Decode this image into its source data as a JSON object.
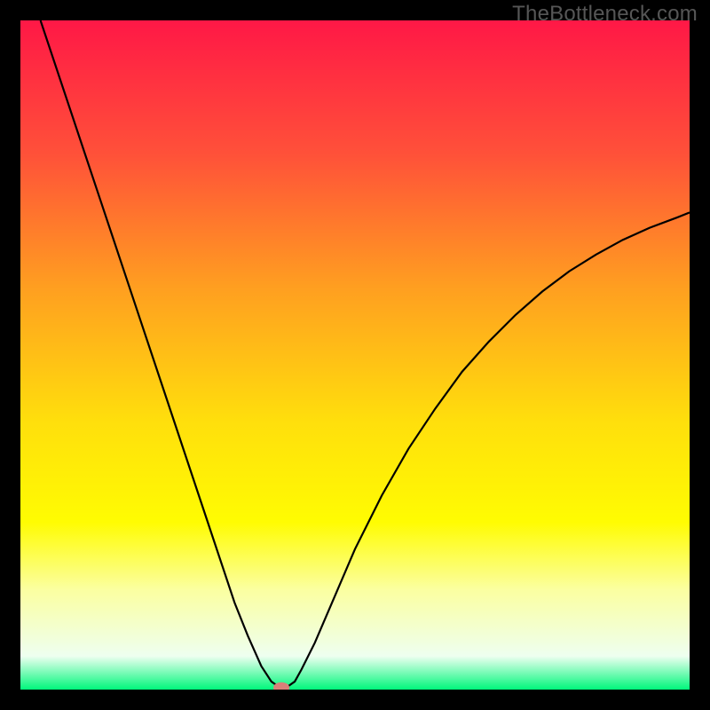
{
  "watermark": "TheBottleneck.com",
  "chart_data": {
    "type": "line",
    "title": "",
    "xlabel": "",
    "ylabel": "",
    "xlim": [
      0,
      100
    ],
    "ylim": [
      0,
      100
    ],
    "grid": false,
    "legend": false,
    "background_gradient": {
      "stops": [
        {
          "pct": 0,
          "color": "#ff1846"
        },
        {
          "pct": 20,
          "color": "#ff5139"
        },
        {
          "pct": 40,
          "color": "#ff9f20"
        },
        {
          "pct": 60,
          "color": "#ffdf0c"
        },
        {
          "pct": 75,
          "color": "#fffc02"
        },
        {
          "pct": 85,
          "color": "#fbffa0"
        },
        {
          "pct": 95,
          "color": "#eefff0"
        },
        {
          "pct": 100,
          "color": "#00f77b"
        }
      ]
    },
    "series": [
      {
        "name": "bottleneck-curve",
        "color": "#000000",
        "width": 2.2,
        "x": [
          3,
          6,
          9,
          12,
          15,
          18,
          21,
          24,
          27,
          30,
          32,
          34,
          36,
          37.5,
          38.5,
          39,
          40,
          41,
          42,
          44,
          47,
          50,
          54,
          58,
          62,
          66,
          70,
          74,
          78,
          82,
          86,
          90,
          94,
          98,
          100
        ],
        "y": [
          100,
          91,
          82,
          73,
          64,
          55,
          46,
          37,
          28,
          19,
          13,
          8,
          3.5,
          1.2,
          0.5,
          0.3,
          0.5,
          1.2,
          3,
          7,
          14,
          21,
          29,
          36,
          42,
          47.5,
          52,
          56,
          59.5,
          62.5,
          65,
          67.2,
          69,
          70.5,
          71.3
        ]
      }
    ],
    "marker": {
      "name": "result-point",
      "x": 39,
      "y": 0.3,
      "color": "#d88079",
      "rx_pct": 1.2,
      "ry_pct": 0.8
    }
  }
}
